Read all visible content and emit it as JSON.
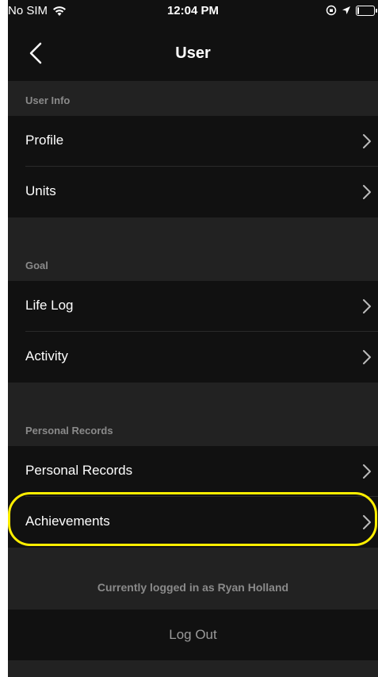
{
  "status_bar": {
    "carrier": "No SIM",
    "time": "12:04 PM",
    "battery_level": 0.1
  },
  "nav": {
    "title": "User",
    "back_icon": "chevron-left-icon"
  },
  "sections": [
    {
      "header": "User Info",
      "rows": [
        "Profile",
        "Units"
      ]
    },
    {
      "header": "Goal",
      "rows": [
        "Life Log",
        "Activity"
      ]
    },
    {
      "header": "Personal Records",
      "rows": [
        "Personal Records",
        "Achievements"
      ]
    }
  ],
  "footer": {
    "logged_in_text": "Currently logged in as Ryan Holland",
    "logout_label": "Log Out"
  },
  "colors": {
    "highlight": "#ffee00",
    "row_bg": "#111111",
    "section_bg": "#222222"
  }
}
